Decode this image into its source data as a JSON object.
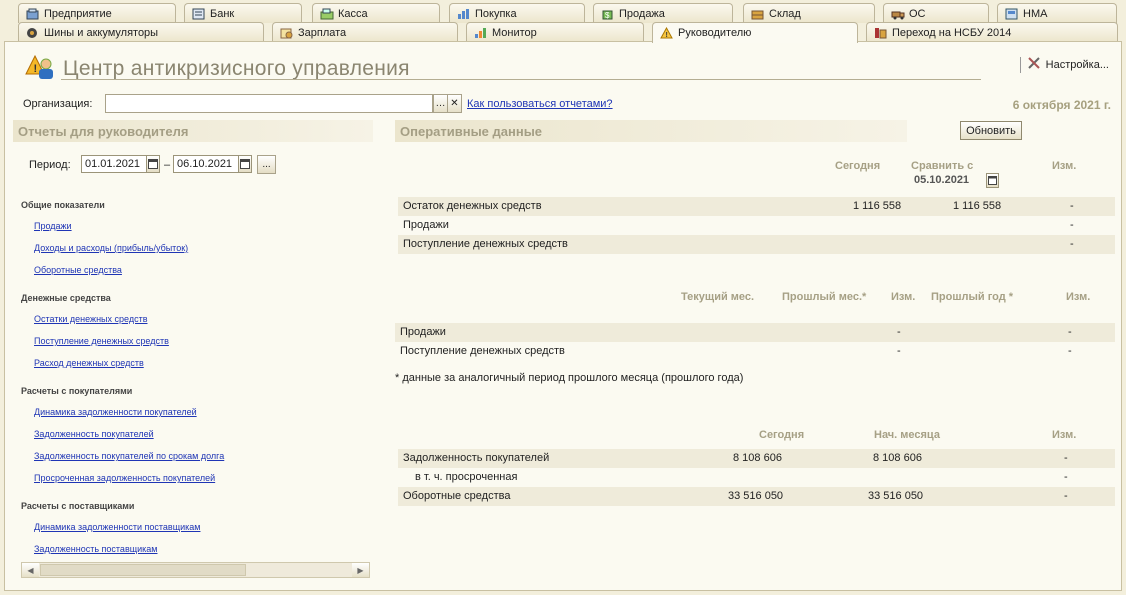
{
  "tabs_row1": [
    "Предприятие",
    "Банк",
    "Касса",
    "Покупка",
    "Продажа",
    "Склад",
    "ОС",
    "НМА"
  ],
  "tabs_row2": [
    "Шины и аккумуляторы",
    "Зарплата",
    "Монитор",
    "Руководителю",
    "Переход на НСБУ 2014"
  ],
  "header": {
    "title": "Центр антикризисного управления",
    "settings_label": "Настройка..."
  },
  "org": {
    "label": "Организация:",
    "value": "",
    "help_link": "Как пользоваться отчетами?",
    "date": "6 октября 2021 г."
  },
  "left": {
    "section_title": "Отчеты для руководителя",
    "period_label": "Период:",
    "date_from": "01.01.2021",
    "date_dash": "–",
    "date_to": "06.10.2021",
    "groups": [
      {
        "title": "Общие показатели",
        "links": [
          "Продажи",
          "Доходы и расходы (прибыль/убыток)",
          "Оборотные средства"
        ]
      },
      {
        "title": "Денежные средства",
        "links": [
          "Остатки денежных средств",
          "Поступление денежных средств",
          "Расход денежных средств"
        ]
      },
      {
        "title": "Расчеты с покупателями",
        "links": [
          "Динамика задолженности покупателей",
          "Задолженность покупателей",
          "Задолженность покупателей по срокам долга",
          "Просроченная задолженность покупателей"
        ]
      },
      {
        "title": "Расчеты с поставщиками",
        "links": [
          "Динамика задолженности поставщикам",
          "Задолженность поставщикам"
        ]
      }
    ]
  },
  "right": {
    "section_title": "Оперативные данные",
    "refresh_label": "Обновить",
    "block1": {
      "col_today": "Сегодня",
      "col_compare": "Сравнить с",
      "compare_date": "05.10.2021",
      "col_change": "Изм.",
      "rows": [
        {
          "label": "Остаток денежных средств",
          "today": "1 116 558",
          "compare": "1 116 558",
          "change": "-"
        },
        {
          "label": "Продажи",
          "today": "",
          "compare": "",
          "change": "-"
        },
        {
          "label": "Поступление денежных средств",
          "today": "",
          "compare": "",
          "change": "-"
        }
      ]
    },
    "block2": {
      "col_cur": "Текущий мес.",
      "col_prev": "Прошлый мес.*",
      "col_change1": "Изм.",
      "col_prevyear": "Прошлый год *",
      "col_change2": "Изм.",
      "rows": [
        {
          "label": "Продажи",
          "change1": "-",
          "change2": "-"
        },
        {
          "label": "Поступление денежных средств",
          "change1": "-",
          "change2": "-"
        }
      ],
      "note": "* данные за аналогичный период прошлого месяца (прошлого года)"
    },
    "block3": {
      "col_today": "Сегодня",
      "col_month_start": "Нач. месяца",
      "col_change": "Изм.",
      "rows": [
        {
          "label": "Задолженность покупателей",
          "today": "8 108 606",
          "month_start": "8 108 606",
          "change": "-"
        },
        {
          "label": "в т. ч. просроченная",
          "today": "",
          "month_start": "",
          "change": "-"
        },
        {
          "label": "Оборотные средства",
          "today": "33 516 050",
          "month_start": "33 516 050",
          "change": "-"
        }
      ]
    }
  }
}
